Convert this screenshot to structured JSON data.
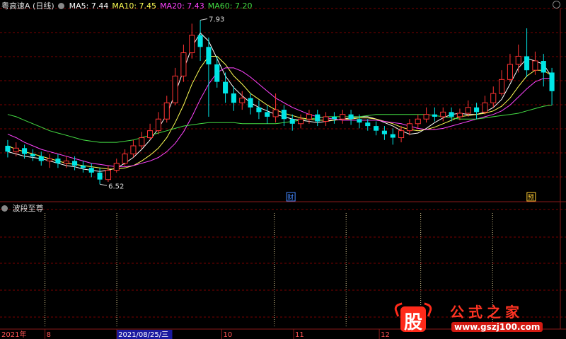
{
  "header": {
    "stock_name": "粤高速A",
    "period": "(日线)",
    "ma_items": [
      {
        "label": "MA5:",
        "value": "7.44",
        "color": "#ffffff"
      },
      {
        "label": "MA10:",
        "value": "7.45",
        "color": "#ffff55"
      },
      {
        "label": "MA20:",
        "value": "7.43",
        "color": "#ff44ff"
      },
      {
        "label": "MA60:",
        "value": "7.20",
        "color": "#44dd44"
      }
    ]
  },
  "sub_panel": {
    "indicator_name": "波段至尊"
  },
  "markers": {
    "cai_label": "财",
    "yu_label": "预"
  },
  "x_axis": {
    "labels": [
      "2021年",
      "8",
      "2021/08/25/三",
      "10",
      "11",
      "12"
    ],
    "highlighted": "2021/08/25/三"
  },
  "colors": {
    "up": "#ff3333",
    "down": "#00e5e5",
    "grid": "#7a0000",
    "bg": "#000000"
  },
  "watermark": {
    "logo_char": "股",
    "text": "公式之家",
    "url": "www.gszj100.com"
  },
  "chart_data": {
    "type": "candlestick",
    "title": "粤高速A (日线)",
    "annotations": [
      {
        "label": "7.93",
        "value": 7.93
      },
      {
        "label": "6.52",
        "value": 6.52
      }
    ],
    "ylim": [
      6.4,
      8.0
    ],
    "x": [
      "2021年",
      "8",
      "2021/08/25/三",
      "10",
      "11",
      "12"
    ],
    "series": [
      {
        "name": "MA5",
        "values": [
          6.8,
          6.78,
          6.76,
          6.75,
          6.74,
          6.72,
          6.7,
          6.68,
          6.67,
          6.65,
          6.64,
          6.63,
          6.64,
          6.66,
          6.7,
          6.75,
          6.82,
          6.9,
          7.0,
          7.12,
          7.3,
          7.5,
          7.7,
          7.82,
          7.75,
          7.6,
          7.45,
          7.35,
          7.28,
          7.22,
          7.18,
          7.15,
          7.12,
          7.1,
          7.08,
          7.07,
          7.06,
          7.05,
          7.06,
          7.07,
          7.08,
          7.09,
          7.1,
          7.1,
          7.08,
          7.05,
          7.02,
          6.98,
          6.95,
          6.96,
          7.0,
          7.05,
          7.09,
          7.12,
          7.13,
          7.12,
          7.12,
          7.14,
          7.18,
          7.25,
          7.38,
          7.52,
          7.6,
          7.58,
          7.55,
          7.44
        ]
      },
      {
        "name": "MA10",
        "values": [
          6.85,
          6.82,
          6.8,
          6.78,
          6.76,
          6.74,
          6.72,
          6.7,
          6.69,
          6.68,
          6.67,
          6.66,
          6.65,
          6.65,
          6.66,
          6.68,
          6.72,
          6.77,
          6.83,
          6.92,
          7.05,
          7.2,
          7.38,
          7.52,
          7.62,
          7.62,
          7.55,
          7.45,
          7.38,
          7.3,
          7.25,
          7.2,
          7.16,
          7.13,
          7.11,
          7.09,
          7.08,
          7.07,
          7.07,
          7.07,
          7.08,
          7.08,
          7.09,
          7.09,
          7.08,
          7.06,
          7.04,
          7.01,
          6.99,
          6.98,
          6.99,
          7.01,
          7.04,
          7.07,
          7.1,
          7.11,
          7.12,
          7.13,
          7.15,
          7.19,
          7.26,
          7.36,
          7.45,
          7.5,
          7.5,
          7.45
        ]
      },
      {
        "name": "MA20",
        "values": [
          6.95,
          6.92,
          6.88,
          6.85,
          6.82,
          6.8,
          6.78,
          6.76,
          6.74,
          6.72,
          6.7,
          6.69,
          6.68,
          6.67,
          6.67,
          6.68,
          6.7,
          6.72,
          6.75,
          6.8,
          6.87,
          6.97,
          7.1,
          7.25,
          7.38,
          7.48,
          7.52,
          7.52,
          7.49,
          7.44,
          7.38,
          7.32,
          7.26,
          7.22,
          7.18,
          7.15,
          7.12,
          7.1,
          7.09,
          7.08,
          7.07,
          7.07,
          7.07,
          7.07,
          7.07,
          7.06,
          7.05,
          7.04,
          7.02,
          7.0,
          6.99,
          6.99,
          7.0,
          7.02,
          7.04,
          7.06,
          7.08,
          7.1,
          7.12,
          7.15,
          7.2,
          7.27,
          7.34,
          7.4,
          7.43,
          7.43
        ]
      },
      {
        "name": "MA60",
        "values": [
          7.12,
          7.1,
          7.07,
          7.04,
          7.01,
          6.98,
          6.96,
          6.94,
          6.92,
          6.9,
          6.89,
          6.88,
          6.88,
          6.88,
          6.89,
          6.9,
          6.92,
          6.94,
          6.96,
          6.98,
          7.0,
          7.02,
          7.03,
          7.04,
          7.05,
          7.05,
          7.05,
          7.05,
          7.04,
          7.04,
          7.04,
          7.04,
          7.04,
          7.05,
          7.06,
          7.07,
          7.08,
          7.09,
          7.1,
          7.1,
          7.1,
          7.1,
          7.1,
          7.11,
          7.12,
          7.12,
          7.12,
          7.12,
          7.12,
          7.12,
          7.12,
          7.11,
          7.1,
          7.09,
          7.08,
          7.08,
          7.08,
          7.09,
          7.1,
          7.11,
          7.12,
          7.13,
          7.15,
          7.17,
          7.19,
          7.2
        ]
      }
    ],
    "candles": [
      {
        "o": 6.85,
        "c": 6.8,
        "h": 6.9,
        "l": 6.75
      },
      {
        "o": 6.8,
        "c": 6.83,
        "h": 6.88,
        "l": 6.76
      },
      {
        "o": 6.83,
        "c": 6.78,
        "h": 6.86,
        "l": 6.74
      },
      {
        "o": 6.78,
        "c": 6.76,
        "h": 6.82,
        "l": 6.72
      },
      {
        "o": 6.76,
        "c": 6.72,
        "h": 6.8,
        "l": 6.68
      },
      {
        "o": 6.72,
        "c": 6.74,
        "h": 6.78,
        "l": 6.66
      },
      {
        "o": 6.74,
        "c": 6.7,
        "h": 6.78,
        "l": 6.66
      },
      {
        "o": 6.7,
        "c": 6.72,
        "h": 6.76,
        "l": 6.66
      },
      {
        "o": 6.72,
        "c": 6.68,
        "h": 6.76,
        "l": 6.64
      },
      {
        "o": 6.68,
        "c": 6.66,
        "h": 6.72,
        "l": 6.62
      },
      {
        "o": 6.66,
        "c": 6.62,
        "h": 6.7,
        "l": 6.58
      },
      {
        "o": 6.62,
        "c": 6.56,
        "h": 6.66,
        "l": 6.52
      },
      {
        "o": 6.56,
        "c": 6.64,
        "h": 6.68,
        "l": 6.54
      },
      {
        "o": 6.64,
        "c": 6.7,
        "h": 6.74,
        "l": 6.62
      },
      {
        "o": 6.7,
        "c": 6.78,
        "h": 6.82,
        "l": 6.68
      },
      {
        "o": 6.78,
        "c": 6.85,
        "h": 6.9,
        "l": 6.75
      },
      {
        "o": 6.85,
        "c": 6.92,
        "h": 6.97,
        "l": 6.82
      },
      {
        "o": 6.92,
        "c": 6.98,
        "h": 7.04,
        "l": 6.9
      },
      {
        "o": 6.98,
        "c": 7.08,
        "h": 7.14,
        "l": 6.95
      },
      {
        "o": 7.08,
        "c": 7.22,
        "h": 7.28,
        "l": 7.05
      },
      {
        "o": 7.22,
        "c": 7.45,
        "h": 7.52,
        "l": 7.2
      },
      {
        "o": 7.45,
        "c": 7.65,
        "h": 7.72,
        "l": 7.4
      },
      {
        "o": 7.65,
        "c": 7.8,
        "h": 7.9,
        "l": 7.6
      },
      {
        "o": 7.8,
        "c": 7.7,
        "h": 7.93,
        "l": 7.58
      },
      {
        "o": 7.7,
        "c": 7.55,
        "h": 7.78,
        "l": 7.1
      },
      {
        "o": 7.55,
        "c": 7.4,
        "h": 7.62,
        "l": 7.35
      },
      {
        "o": 7.4,
        "c": 7.3,
        "h": 7.48,
        "l": 7.22
      },
      {
        "o": 7.3,
        "c": 7.22,
        "h": 7.36,
        "l": 7.15
      },
      {
        "o": 7.22,
        "c": 7.26,
        "h": 7.32,
        "l": 7.16
      },
      {
        "o": 7.26,
        "c": 7.18,
        "h": 7.3,
        "l": 7.12
      },
      {
        "o": 7.18,
        "c": 7.14,
        "h": 7.24,
        "l": 7.08
      },
      {
        "o": 7.14,
        "c": 7.1,
        "h": 7.2,
        "l": 7.04
      },
      {
        "o": 7.1,
        "c": 7.16,
        "h": 7.3,
        "l": 7.05
      },
      {
        "o": 7.16,
        "c": 7.08,
        "h": 7.2,
        "l": 7.02
      },
      {
        "o": 7.08,
        "c": 7.04,
        "h": 7.12,
        "l": 6.98
      },
      {
        "o": 7.04,
        "c": 7.08,
        "h": 7.12,
        "l": 7.0
      },
      {
        "o": 7.08,
        "c": 7.12,
        "h": 7.16,
        "l": 7.04
      },
      {
        "o": 7.12,
        "c": 7.06,
        "h": 7.16,
        "l": 7.02
      },
      {
        "o": 7.06,
        "c": 7.1,
        "h": 7.14,
        "l": 7.02
      },
      {
        "o": 7.1,
        "c": 7.08,
        "h": 7.14,
        "l": 7.04
      },
      {
        "o": 7.08,
        "c": 7.12,
        "h": 7.16,
        "l": 7.04
      },
      {
        "o": 7.12,
        "c": 7.08,
        "h": 7.16,
        "l": 7.03
      },
      {
        "o": 7.08,
        "c": 7.05,
        "h": 7.12,
        "l": 7.0
      },
      {
        "o": 7.05,
        "c": 7.02,
        "h": 7.08,
        "l": 6.98
      },
      {
        "o": 7.02,
        "c": 6.98,
        "h": 7.06,
        "l": 6.94
      },
      {
        "o": 6.98,
        "c": 6.95,
        "h": 7.02,
        "l": 6.9
      },
      {
        "o": 6.95,
        "c": 6.92,
        "h": 7.0,
        "l": 6.86
      },
      {
        "o": 6.92,
        "c": 6.98,
        "h": 7.02,
        "l": 6.88
      },
      {
        "o": 6.98,
        "c": 7.04,
        "h": 7.08,
        "l": 6.94
      },
      {
        "o": 7.04,
        "c": 7.08,
        "h": 7.12,
        "l": 7.0
      },
      {
        "o": 7.08,
        "c": 7.12,
        "h": 7.18,
        "l": 7.05
      },
      {
        "o": 7.12,
        "c": 7.1,
        "h": 7.18,
        "l": 7.06
      },
      {
        "o": 7.1,
        "c": 7.14,
        "h": 7.18,
        "l": 7.06
      },
      {
        "o": 7.14,
        "c": 7.1,
        "h": 7.18,
        "l": 7.06
      },
      {
        "o": 7.1,
        "c": 7.13,
        "h": 7.17,
        "l": 7.07
      },
      {
        "o": 7.13,
        "c": 7.18,
        "h": 7.24,
        "l": 7.1
      },
      {
        "o": 7.18,
        "c": 7.14,
        "h": 7.22,
        "l": 7.08
      },
      {
        "o": 7.14,
        "c": 7.22,
        "h": 7.28,
        "l": 7.12
      },
      {
        "o": 7.22,
        "c": 7.3,
        "h": 7.36,
        "l": 7.18
      },
      {
        "o": 7.3,
        "c": 7.42,
        "h": 7.5,
        "l": 7.28
      },
      {
        "o": 7.42,
        "c": 7.55,
        "h": 7.64,
        "l": 7.4
      },
      {
        "o": 7.55,
        "c": 7.62,
        "h": 7.72,
        "l": 7.48
      },
      {
        "o": 7.62,
        "c": 7.5,
        "h": 7.86,
        "l": 7.44
      },
      {
        "o": 7.5,
        "c": 7.58,
        "h": 7.66,
        "l": 7.46
      },
      {
        "o": 7.58,
        "c": 7.48,
        "h": 7.64,
        "l": 7.36
      },
      {
        "o": 7.48,
        "c": 7.32,
        "h": 7.52,
        "l": 7.2
      }
    ],
    "sub_signals": [
      "8",
      "2021/08/25/三",
      "10",
      "11",
      "12"
    ]
  }
}
